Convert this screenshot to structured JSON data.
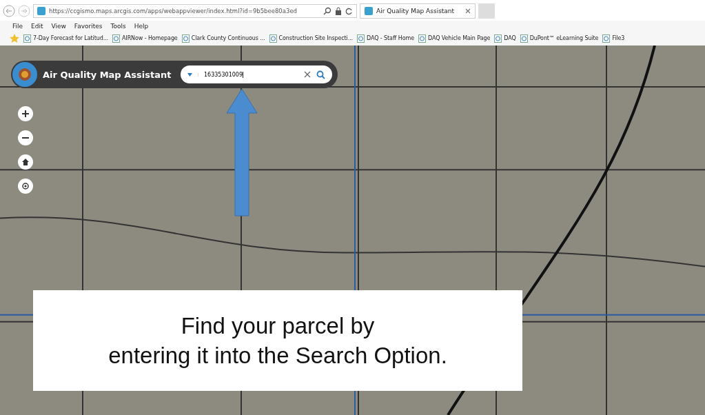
{
  "browser": {
    "url": "https://ccgismo.maps.arcgis.com/apps/webappviewer/index.html?id=9b5bee80a3ed",
    "tabs": [
      {
        "label": "Air Quality Map Assistant",
        "selected": true
      }
    ],
    "menu": [
      "File",
      "Edit",
      "View",
      "Favorites",
      "Tools",
      "Help"
    ],
    "favorites": [
      "7-Day Forecast for Latitud...",
      "AIRNow - Homepage",
      "Clark County Continuous ...",
      "Construction Site Inspecti...",
      "DAQ - Staff Home",
      "DAQ Vehicle Main Page",
      "DAQ",
      "DuPont™ eLearning Suite",
      "File3"
    ]
  },
  "app": {
    "title": "Air Quality Map Assistant",
    "search": {
      "value": "16335301009"
    }
  },
  "callout": {
    "text": "Find your parcel by\nentering it into the Search Option."
  }
}
